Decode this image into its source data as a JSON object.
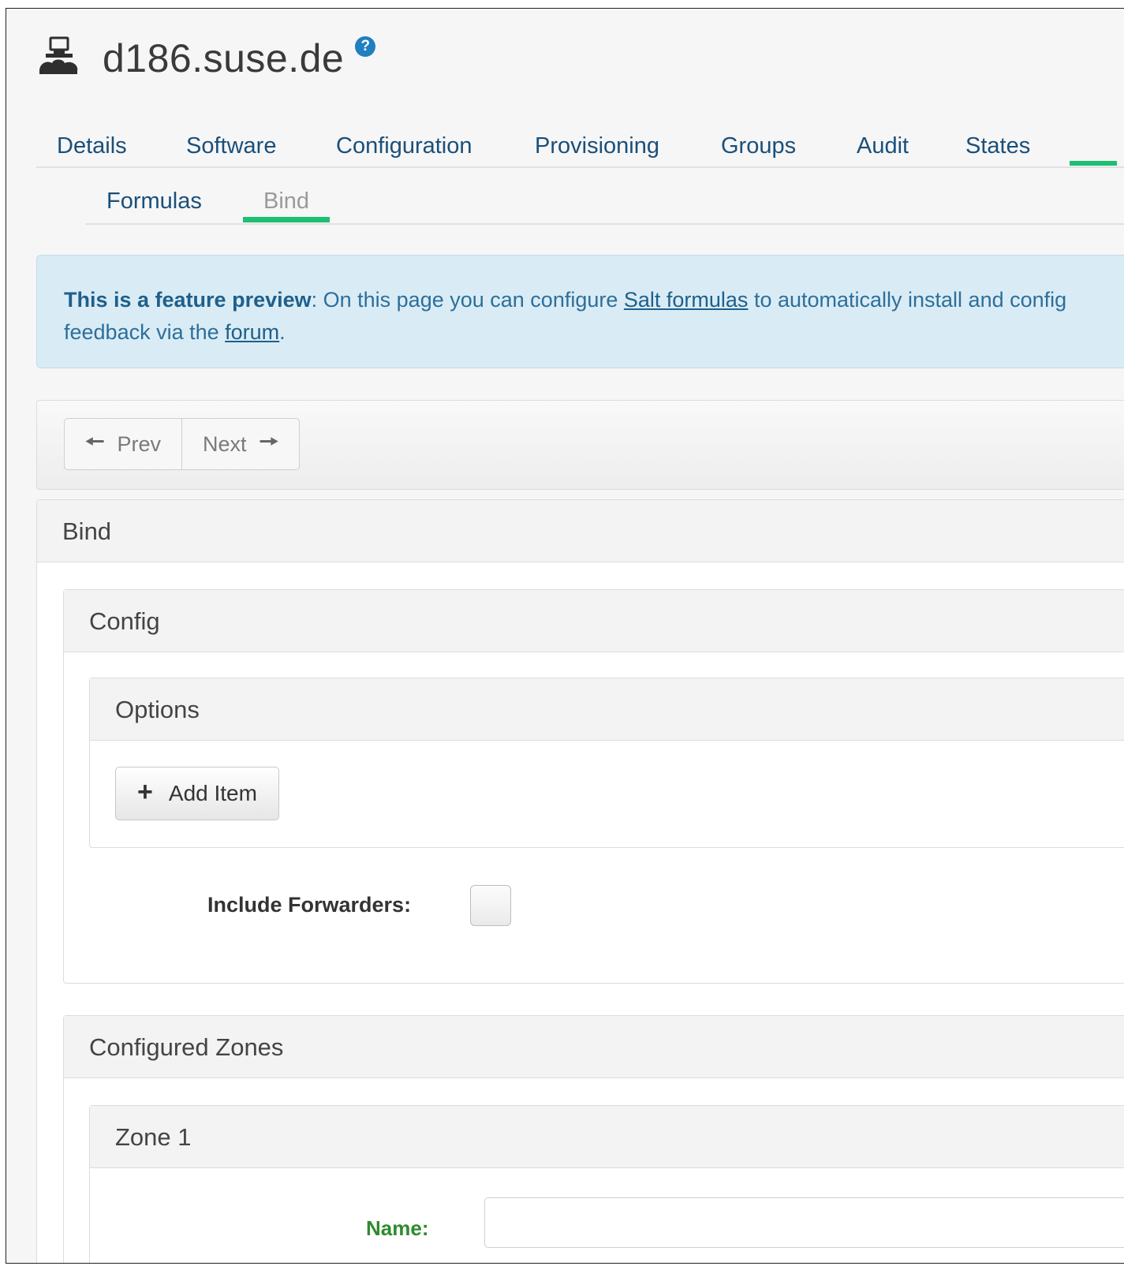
{
  "header": {
    "title": "d186.suse.de",
    "help_glyph": "?",
    "icon": "server-salt-icon"
  },
  "main_tabs": [
    "Details",
    "Software",
    "Configuration",
    "Provisioning",
    "Groups",
    "Audit",
    "States"
  ],
  "sub_tabs": {
    "formulas": "Formulas",
    "bind": "Bind"
  },
  "alert": {
    "strong": "This is a feature preview",
    "text1": ": On this page you can configure ",
    "link1": "Salt formulas",
    "text2": " to automatically install and config",
    "text3": "feedback via the ",
    "link2": "forum",
    "text4": "."
  },
  "pager": {
    "prev": "Prev",
    "next": "Next"
  },
  "panels": {
    "bind": "Bind",
    "config": "Config",
    "options": "Options",
    "zones": "Configured Zones",
    "zone1": "Zone 1"
  },
  "options": {
    "add_item": "Add Item"
  },
  "config": {
    "include_forwarders_label": "Include Forwarders:",
    "include_forwarders_checked": false
  },
  "zone": {
    "name_label": "Name:",
    "name_value": ""
  },
  "colors": {
    "accent_green": "#1dbf73",
    "link_blue": "#1a4f7a",
    "alert_bg": "#d9ecf5",
    "help_blue": "#1f7fc0"
  }
}
